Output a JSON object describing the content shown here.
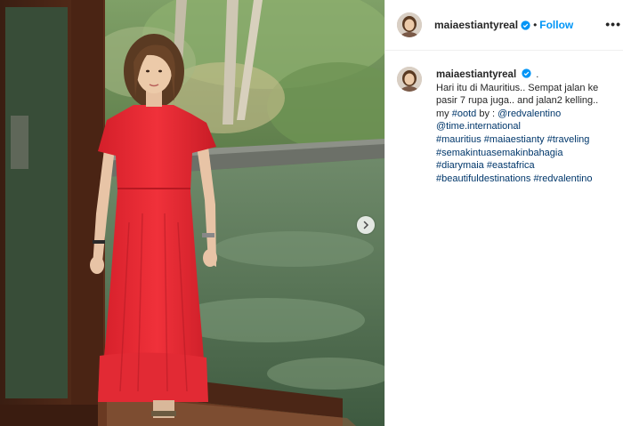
{
  "post": {
    "username": "maiaestiantyreal",
    "follow_label": "Follow",
    "separator": "•",
    "more_label": "•••",
    "verified_icon": "verified-badge-icon",
    "accent_color": "#0095f6",
    "caption": {
      "username": "maiaestiantyreal",
      "dot": ".",
      "text_line_1": "Hari itu di Mauritius.. Sempat jalan ke",
      "text_line_2": "pasir 7 rupa juga.. and jalan2 kelling..",
      "text_line_3_prefix": "my ",
      "ootd_tag": "#ootd",
      "text_line_3_mid": " by : ",
      "mention_1": "@redvalentino",
      "mention_2": "@time.international",
      "hashtags_line_1": "#mauritius #maiaestianty #traveling",
      "hashtags_line_2": "#semakintuasemakinbahagia",
      "hashtags_line_3": "#diarymaia #eastafrica",
      "hashtags_line_4": "#beautifuldestinations #redvalentino"
    }
  },
  "photo": {
    "alt_subject": "woman-in-red-dress-photo",
    "next_icon": "chevron-right-icon"
  }
}
